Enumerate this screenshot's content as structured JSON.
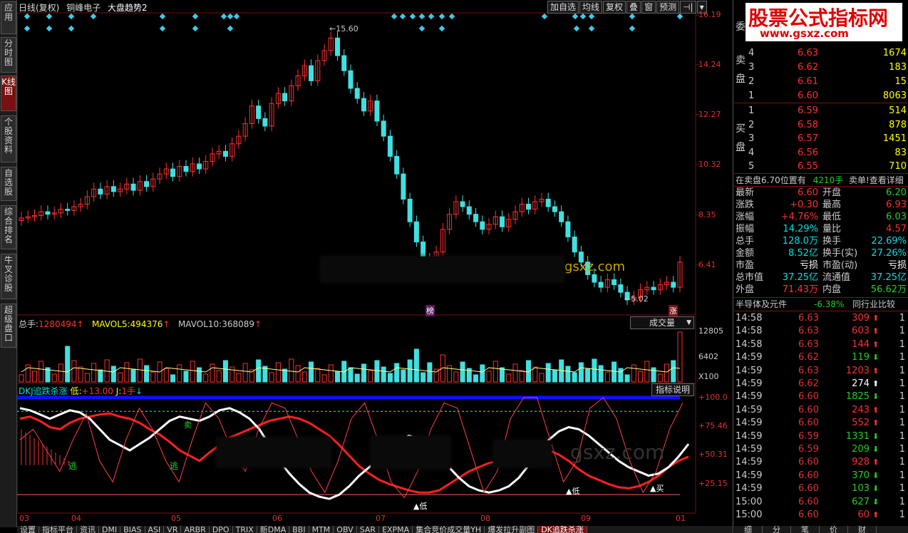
{
  "leftnav": [
    {
      "label": "应用"
    },
    {
      "label": "分时图"
    },
    {
      "label": "K线图"
    },
    {
      "label": "个股资料"
    },
    {
      "label": "自选股"
    },
    {
      "label": "综合排名"
    },
    {
      "label": "牛叉诊股"
    },
    {
      "label": "超级盘口"
    }
  ],
  "title": {
    "period": "日线(复权)",
    "stock": "铜峰电子",
    "indicator": "大盘趋势2"
  },
  "toolbar": [
    "加自选",
    "均线",
    "复权",
    "叠",
    "窗",
    "预测",
    "⊣|",
    "▾"
  ],
  "price_axis": [
    "16.19",
    "14.24",
    "12.27",
    "10.32",
    "8.35",
    "6.41"
  ],
  "annotations": {
    "high": "15.60",
    "low": "5.02",
    "bang": "榜",
    "zhang": "涨"
  },
  "volume": {
    "label_total": "总手:",
    "total": "1280494",
    "label_ma5": "MAVOL5:",
    "ma5": "494376",
    "label_ma10": "MAVOL10:",
    "ma10": "368089",
    "selector": "成交量",
    "axis": [
      "12805",
      "6402",
      "X100"
    ]
  },
  "indicator": {
    "name": "DKJ追跌杀涨",
    "low_label": "低:",
    "low": "+13.00",
    "j_label": "J:",
    "j": "1手",
    "help": "指标说明",
    "axis": [
      "+100.0",
      "+75.46",
      "+50.31",
      "+25.15"
    ],
    "signals": {
      "escape": "逃",
      "sell": "卖",
      "buy": "买",
      "low": "低"
    }
  },
  "dates": [
    "03",
    "04",
    "05",
    "06",
    "07",
    "08",
    "09",
    "01"
  ],
  "watermark": "gsxz.com",
  "bottom_tabs": [
    "设置",
    "指标平台",
    "资讯",
    "DMI",
    "BIAS",
    "ASI",
    "VR",
    "ARBR",
    "DPO",
    "TRIX",
    "新DMA",
    "BBI",
    "MTM",
    "OBV",
    "SAR",
    "EXPMA",
    "集合竞价成交量YH",
    "爆发拉升副图",
    "DK追跌杀涨"
  ],
  "logo": {
    "text": "股票公式指标网",
    "url": "www.gsxz.com"
  },
  "orderbook": {
    "wei_label": "委",
    "sell_label": "卖盘",
    "buy_label": "买盘",
    "sell": [
      {
        "lv": "4",
        "price": "6.63",
        "vol": "1674"
      },
      {
        "lv": "3",
        "price": "6.62",
        "vol": "183"
      },
      {
        "lv": "2",
        "price": "6.61",
        "vol": "15"
      },
      {
        "lv": "1",
        "price": "6.60",
        "vol": "8063"
      }
    ],
    "buy": [
      {
        "lv": "1",
        "price": "6.59",
        "vol": "514"
      },
      {
        "lv": "2",
        "price": "6.58",
        "vol": "878"
      },
      {
        "lv": "3",
        "price": "6.57",
        "vol": "1451"
      },
      {
        "lv": "4",
        "price": "6.56",
        "vol": "83"
      },
      {
        "lv": "5",
        "price": "6.55",
        "vol": "710"
      }
    ],
    "notice_a": "在卖盘6.70位置有",
    "notice_b": "4210手",
    "notice_c": "卖单!",
    "notice_link": "查看详细"
  },
  "quote": [
    {
      "k1": "最新",
      "v1": "6.60",
      "k2": "开盘",
      "v2": "6.20",
      "c1": "red",
      "c2": "grn"
    },
    {
      "k1": "涨跌",
      "v1": "+0.30",
      "k2": "最高",
      "v2": "6.93",
      "c1": "red",
      "c2": "red"
    },
    {
      "k1": "涨幅",
      "v1": "+4.76%",
      "k2": "最低",
      "v2": "6.03",
      "c1": "red",
      "c2": "grn"
    },
    {
      "k1": "振幅",
      "v1": "14.29%",
      "k2": "量比",
      "v2": "4.57",
      "c1": "cyan",
      "c2": "red"
    },
    {
      "k1": "总手",
      "v1": "128.0万",
      "k2": "换手",
      "v2": "22.69%",
      "c1": "cyan",
      "c2": "cyan"
    },
    {
      "k1": "金额",
      "v1": "8.52亿",
      "k2": "换手(实)",
      "v2": "27.26%",
      "c1": "cyan",
      "c2": "cyan"
    },
    {
      "k1": "市盈",
      "v1": "亏损",
      "k2": "市盈(动)",
      "v2": "亏损",
      "c1": "wht",
      "c2": "wht"
    },
    {
      "k1": "总市值",
      "v1": "37.25亿",
      "k2": "流通值",
      "v2": "37.25亿",
      "c1": "cyan",
      "c2": "cyan"
    },
    {
      "k1": "外盘",
      "v1": "71.43万",
      "k2": "内盘",
      "v2": "56.62万",
      "c1": "red",
      "c2": "grn"
    }
  ],
  "sector": {
    "name": "半导体及元件",
    "chg": "-6.38%",
    "link": "同行业比较"
  },
  "ticks": [
    {
      "t": "14:58",
      "p": "6.63",
      "v": "309",
      "d": "up",
      "n": "1"
    },
    {
      "t": "14:58",
      "p": "6.63",
      "v": "603",
      "d": "up",
      "n": "1"
    },
    {
      "t": "14:58",
      "p": "6.63",
      "v": "144",
      "d": "up",
      "n": "1"
    },
    {
      "t": "14:59",
      "p": "6.62",
      "v": "119",
      "d": "dn",
      "n": "1"
    },
    {
      "t": "14:59",
      "p": "6.63",
      "v": "1203",
      "d": "up",
      "n": "1"
    },
    {
      "t": "14:59",
      "p": "6.62",
      "v": "274",
      "d": "wup",
      "n": "1"
    },
    {
      "t": "14:59",
      "p": "6.60",
      "v": "1825",
      "d": "dn",
      "n": "1"
    },
    {
      "t": "14:59",
      "p": "6.60",
      "v": "243",
      "d": "up",
      "n": "1"
    },
    {
      "t": "14:59",
      "p": "6.60",
      "v": "552",
      "d": "up",
      "n": "1"
    },
    {
      "t": "14:59",
      "p": "6.59",
      "v": "1331",
      "d": "dn",
      "n": "1"
    },
    {
      "t": "14:59",
      "p": "6.59",
      "v": "209",
      "d": "dn",
      "n": "1"
    },
    {
      "t": "14:59",
      "p": "6.60",
      "v": "928",
      "d": "up",
      "n": "1"
    },
    {
      "t": "14:59",
      "p": "6.60",
      "v": "370",
      "d": "dn",
      "n": "1"
    },
    {
      "t": "14:59",
      "p": "6.60",
      "v": "103",
      "d": "dn",
      "n": "1"
    },
    {
      "t": "15:00",
      "p": "6.60",
      "v": "627",
      "d": "dn",
      "n": "1"
    },
    {
      "t": "15:00",
      "p": "6.60",
      "v": "60",
      "d": "up",
      "n": "1"
    }
  ],
  "right_tabs": [
    "细",
    "分",
    "笔",
    "价",
    "财"
  ],
  "colors": {
    "up": "#ff3030",
    "down": "#40e0e0",
    "grid": "#7a1010",
    "ma": "#ffff00"
  }
}
